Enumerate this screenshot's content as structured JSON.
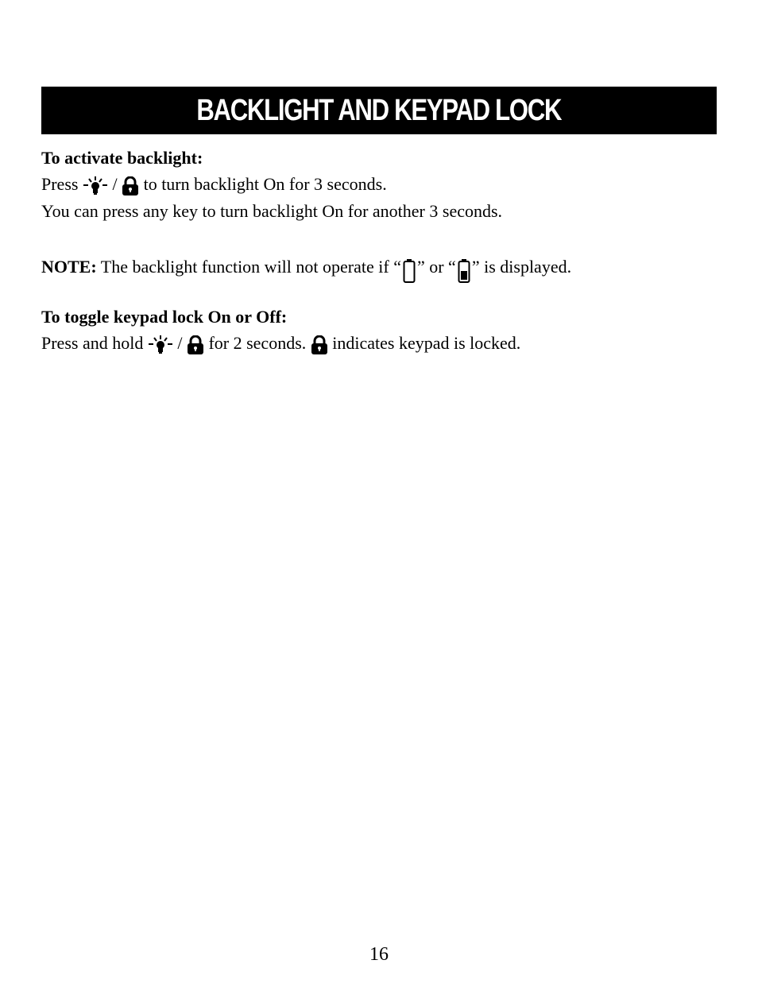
{
  "header": {
    "title": "BACKLIGHT AND KEYPAD LOCK"
  },
  "section_backlight": {
    "heading": "To activate backlight:",
    "line1_prefix": "Press",
    "line1_icons": [
      "backlight-bulb-icon",
      "lock-icon"
    ],
    "line1_separator": "/",
    "line1_suffix": "to turn backlight On for 3 seconds.",
    "line2": "You can press any key to turn backlight On for another 3 seconds."
  },
  "note": {
    "label": "NOTE:",
    "text_before": "The backlight function will not operate if “",
    "icon1": "battery-empty-icon",
    "text_middle": "” or “",
    "icon2": "battery-low-icon",
    "text_after": "” is displayed."
  },
  "section_keypad": {
    "heading": "To toggle keypad lock On or Off:",
    "prefix": "Press and hold",
    "icons": [
      "backlight-bulb-icon",
      "lock-icon"
    ],
    "separator": "/",
    "middle": "for 2 seconds.",
    "status_icon": "lock-icon",
    "suffix": "indicates keypad is locked."
  },
  "footer": {
    "page_number": "16"
  }
}
